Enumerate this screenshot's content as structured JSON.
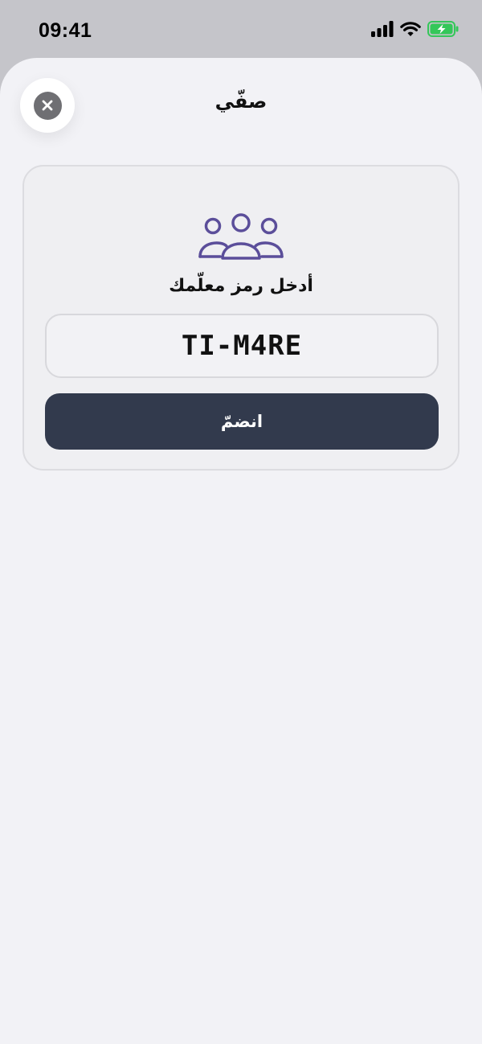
{
  "status_bar": {
    "time": "09:41",
    "icons": [
      "cellular-signal-icon",
      "wifi-icon",
      "battery-charging-icon"
    ],
    "battery_color": "#34c759"
  },
  "sheet": {
    "title": "صفّي",
    "close_icon": "close-icon"
  },
  "join_card": {
    "icon": "group-icon",
    "icon_color": "#5b4e9a",
    "prompt": "أدخل رمز معلّمك",
    "code_value": "TI-M4RE",
    "join_label": "انضمّ",
    "button_color": "#323a4d"
  }
}
